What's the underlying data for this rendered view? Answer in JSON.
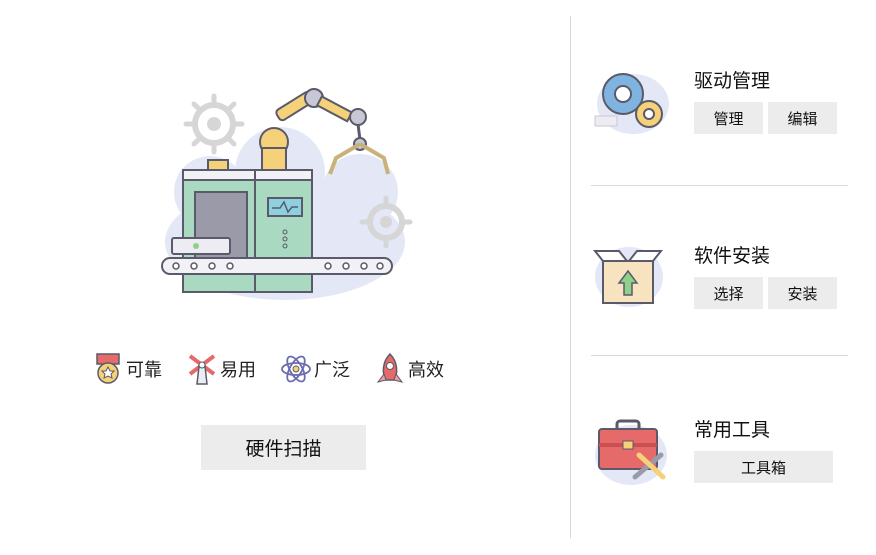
{
  "features": [
    {
      "label": "可靠",
      "icon": "medal-icon"
    },
    {
      "label": "易用",
      "icon": "windmill-icon"
    },
    {
      "label": "广泛",
      "icon": "atom-icon"
    },
    {
      "label": "高效",
      "icon": "rocket-icon"
    }
  ],
  "scan_button": "硬件扫描",
  "sections": {
    "driver": {
      "title": "驱动管理",
      "manage": "管理",
      "edit": "编辑",
      "icon": "gears-icon"
    },
    "software": {
      "title": "软件安装",
      "select": "选择",
      "install": "安装",
      "icon": "box-upload-icon"
    },
    "tools": {
      "title": "常用工具",
      "toolbox": "工具箱",
      "icon": "toolbox-icon"
    }
  },
  "hero_icon": "factory-robot-arm-illustration"
}
